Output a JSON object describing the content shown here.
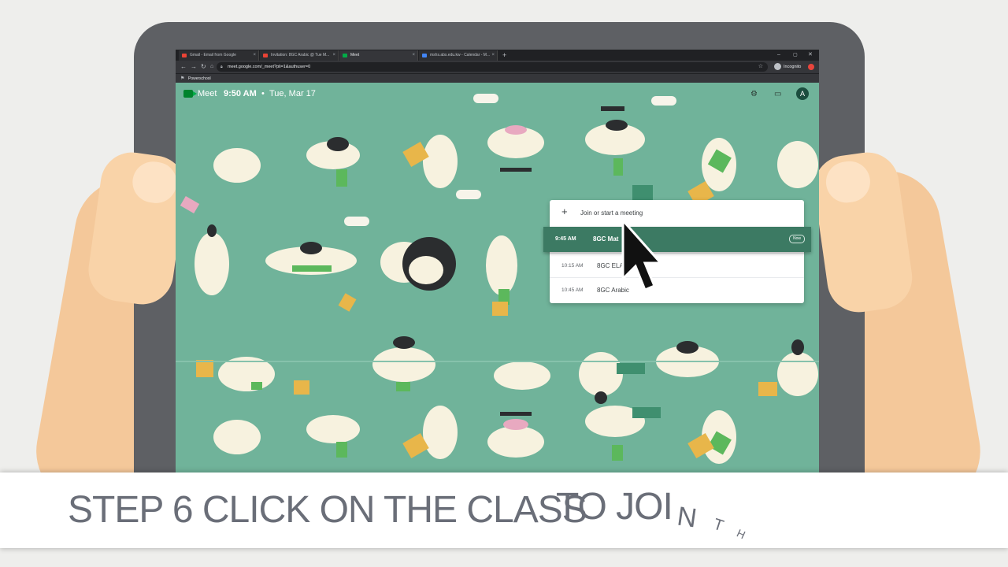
{
  "browser": {
    "tabs": [
      {
        "title": "Gmail - Email from Google",
        "fav_color": "#ea4335"
      },
      {
        "title": "Invitation: 8GC Arabic @ Tue M...",
        "fav_color": "#ea4335"
      },
      {
        "title": "Meet",
        "fav_color": "#00ac47"
      },
      {
        "title": "mshs.abs.edu.kw - Calendar - M...",
        "fav_color": "#4285f4"
      }
    ],
    "new_tab_label": "+",
    "url": "meet.google.com/_meet?pli=1&authuser=0",
    "incognito_label": "Incognito",
    "bookmark": "Powerschool"
  },
  "meet": {
    "app_name": "Meet",
    "time": "9:50 AM",
    "date": "Tue, Mar 17",
    "avatar_initial": "A"
  },
  "panel": {
    "join_label": "Join or start a meeting",
    "meetings": [
      {
        "time": "9:45 AM",
        "name": "8GC Mat",
        "badge": "Now",
        "selected": true
      },
      {
        "time": "10:15 AM",
        "name": "8GC ELA"
      },
      {
        "time": "10:45 AM",
        "name": "8GC Arabic"
      }
    ]
  },
  "caption": {
    "part1": "STEP 6 CLICK ON THE CLASS",
    "part2": "TO JOI",
    "part3": "N",
    "part4": "T",
    "part5": "H"
  },
  "colors": {
    "meet_bg": "#70b39a",
    "selected_row": "#3c7a63",
    "tablet": "#5e6064",
    "hand": "#f4c89a"
  }
}
